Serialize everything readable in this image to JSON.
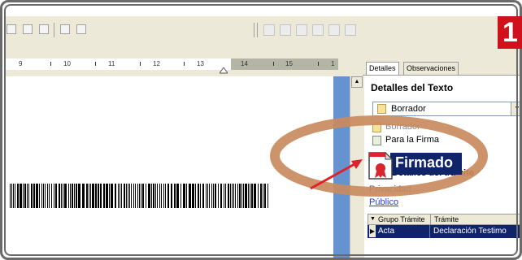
{
  "step_badge": "1",
  "ruler": {
    "labels": [
      "9",
      "10",
      "11",
      "12",
      "13",
      "14",
      "15",
      "1"
    ]
  },
  "panel": {
    "tabs": [
      {
        "label": "Detalles",
        "active": true
      },
      {
        "label": "Observaciones",
        "active": false
      }
    ],
    "section_title": "Detalles del Texto",
    "status_select": {
      "selected": "Borrador",
      "options": [
        "Borrador",
        "Para la Firma",
        "Firmado"
      ]
    },
    "hidden_heading": "Detalles del trámite",
    "privacy": {
      "label": "Privacidad",
      "value": "Público"
    },
    "table": {
      "headers": [
        "Grupo Trámite",
        "Trámite"
      ],
      "rows": [
        {
          "group": "Acta",
          "tramite": "Declaración Testimo"
        }
      ]
    }
  },
  "highlight": {
    "label": "Firmado",
    "ellipse_color": "#c98a5e",
    "arrow_color": "#e0202a"
  },
  "icons": [
    "open-icon",
    "save-icon",
    "copy-icon",
    "grid-icon",
    "table-icon",
    "scroll-up-icon",
    "dropdown-arrow-icon",
    "document-icon",
    "signed-document-icon",
    "seal-icon"
  ]
}
